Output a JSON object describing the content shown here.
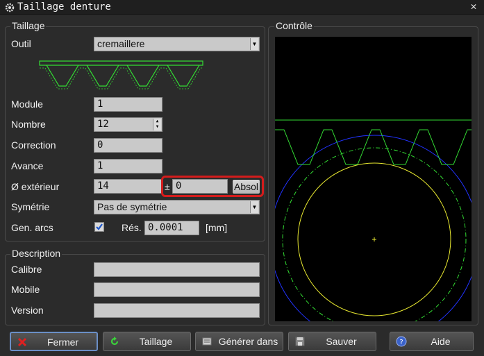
{
  "window": {
    "title": "Taillage denture",
    "close_glyph": "✕"
  },
  "taillage": {
    "legend": "Taillage",
    "outil_label": "Outil",
    "outil_value": "cremaillere",
    "module_label": "Module",
    "module_value": "1",
    "nombre_label": "Nombre",
    "nombre_value": "12",
    "correction_label": "Correction",
    "correction_value": "0",
    "avance_label": "Avance",
    "avance_value": "1",
    "diam_label": "Ø extérieur",
    "diam_value": "14",
    "tol_sign": "±",
    "tol_value": "0",
    "absol_label": "Absol",
    "symetrie_label": "Symétrie",
    "symetrie_value": "Pas de symétrie",
    "gen_arcs_label": "Gen. arcs",
    "gen_arcs_checked": true,
    "res_label": "Rés.",
    "res_value": "0.0001",
    "res_unit": "[mm]"
  },
  "description": {
    "legend": "Description",
    "calibre_label": "Calibre",
    "calibre_value": "",
    "mobile_label": "Mobile",
    "mobile_value": "",
    "version_label": "Version",
    "version_value": ""
  },
  "controle": {
    "legend": "Contrôle"
  },
  "buttons": {
    "fermer": "Fermer",
    "taillage": "Taillage",
    "generer": "Générer dans",
    "sauver": "Sauver",
    "aide": "Aide"
  },
  "colors": {
    "rack": "#33dd33",
    "outer_circle": "#2233ff",
    "pitch_circle": "#33dd33",
    "root_circle": "#e8e830",
    "highlight": "#d41c1c"
  },
  "icons": {
    "app": "gear-icon",
    "close": "close-icon",
    "fermer": "red-x-icon",
    "taillage": "green-refresh-icon",
    "generer": "document-icon",
    "sauver": "floppy-icon",
    "aide": "help-icon"
  }
}
